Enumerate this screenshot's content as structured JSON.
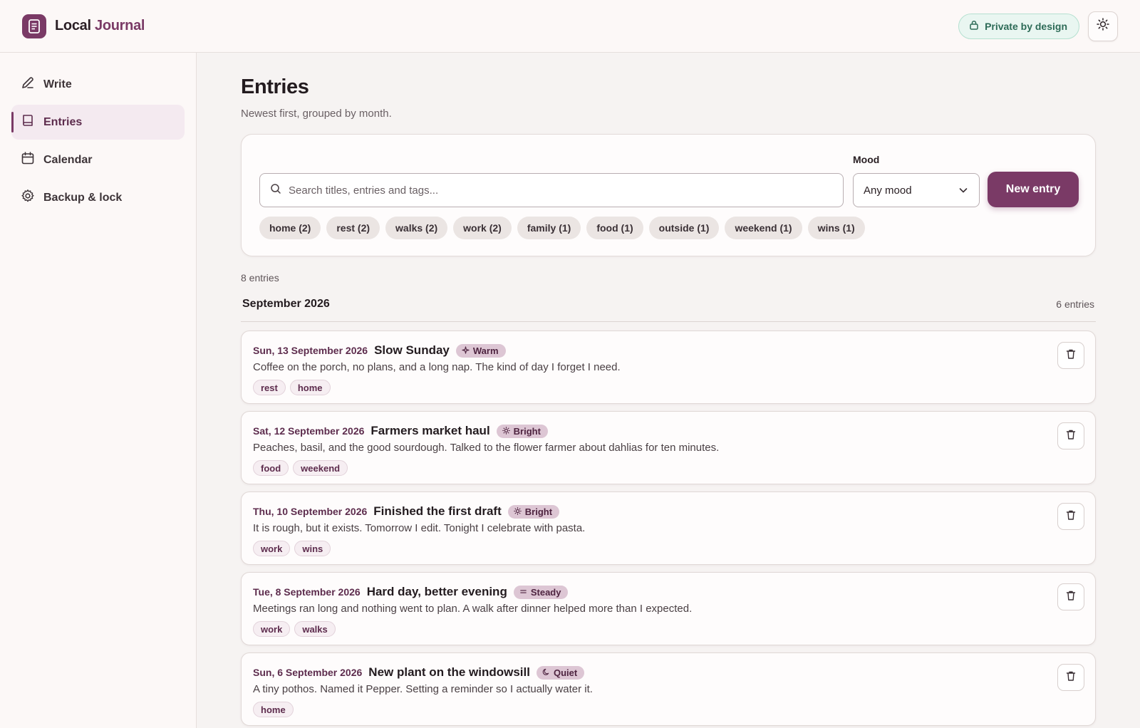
{
  "header": {
    "app_name_a": "Local",
    "app_name_b": "Journal",
    "privacy_label": "Private by design",
    "icons": [
      "journal-logo-icon",
      "lock-icon",
      "sun-icon"
    ]
  },
  "sidebar": {
    "items": [
      {
        "label": "Write",
        "icon": "pen-icon",
        "active": false
      },
      {
        "label": "Entries",
        "icon": "book-icon",
        "active": true
      },
      {
        "label": "Calendar",
        "icon": "calendar-icon",
        "active": false
      },
      {
        "label": "Backup & lock",
        "icon": "gear-icon",
        "active": false
      }
    ]
  },
  "main": {
    "title": "Entries",
    "subtitle": "Newest first, grouped by month.",
    "search": {
      "placeholder": "Search titles, entries and tags...",
      "value": ""
    },
    "mood": {
      "label": "Mood",
      "selected": "Any mood"
    },
    "new_entry_label": "New entry",
    "tag_filters": [
      "home (2)",
      "rest (2)",
      "walks (2)",
      "work (2)",
      "family (1)",
      "food (1)",
      "outside (1)",
      "weekend (1)",
      "wins (1)"
    ],
    "total_count": "8 entries",
    "month": {
      "title": "September 2026",
      "count": "6 entries"
    },
    "entries": [
      {
        "date": "Sun, 13 September 2026",
        "title": "Slow Sunday",
        "mood": "Warm",
        "mood_icon": "sparkle-icon",
        "body": "Coffee on the porch, no plans, and a long nap. The kind of day I forget I need.",
        "tags": [
          "rest",
          "home"
        ]
      },
      {
        "date": "Sat, 12 September 2026",
        "title": "Farmers market haul",
        "mood": "Bright",
        "mood_icon": "sun-icon",
        "body": "Peaches, basil, and the good sourdough. Talked to the flower farmer about dahlias for ten minutes.",
        "tags": [
          "food",
          "weekend"
        ]
      },
      {
        "date": "Thu, 10 September 2026",
        "title": "Finished the first draft",
        "mood": "Bright",
        "mood_icon": "sun-icon",
        "body": "It is rough, but it exists. Tomorrow I edit. Tonight I celebrate with pasta.",
        "tags": [
          "work",
          "wins"
        ]
      },
      {
        "date": "Tue, 8 September 2026",
        "title": "Hard day, better evening",
        "mood": "Steady",
        "mood_icon": "equals-icon",
        "body": "Meetings ran long and nothing went to plan. A walk after dinner helped more than I expected.",
        "tags": [
          "work",
          "walks"
        ]
      },
      {
        "date": "Sun, 6 September 2026",
        "title": "New plant on the windowsill",
        "mood": "Quiet",
        "mood_icon": "moon-icon",
        "body": "A tiny pothos. Named it Pepper. Setting a reminder so I actually water it.",
        "tags": [
          "home"
        ]
      }
    ]
  },
  "colors": {
    "accent": "#7a3a66",
    "privacy_green": "#2d6b57",
    "background": "#f6f3f2"
  }
}
